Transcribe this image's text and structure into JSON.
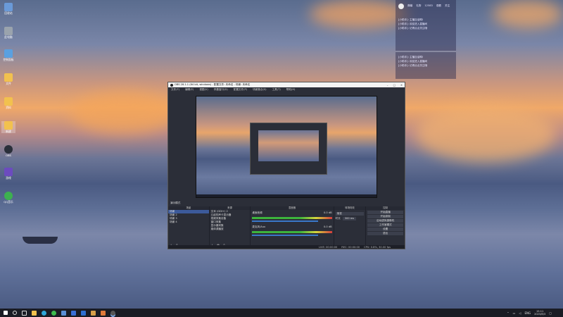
{
  "desktop": {
    "icons": [
      {
        "label": "回收站",
        "icon": "recycle-bin-icon",
        "color": "#6a9ad8"
      },
      {
        "label": "此电脑",
        "icon": "computer-icon",
        "color": "#9aa3ad"
      },
      {
        "label": "控制面板",
        "icon": "control-panel-icon",
        "color": "#5aa0e0"
      },
      {
        "label": "文件",
        "icon": "folder-icon",
        "color": "#f2c14e"
      },
      {
        "label": "资料",
        "icon": "folder-icon",
        "color": "#f2c14e"
      },
      {
        "label": "新建",
        "icon": "folder-icon",
        "color": "#f2c14e"
      },
      {
        "label": "OBS",
        "icon": "obs-icon",
        "color": "#2a2f3a"
      },
      {
        "label": "游戏",
        "icon": "game-icon",
        "color": "#6c4bbf"
      },
      {
        "label": "QQ音乐",
        "icon": "music-icon",
        "color": "#3db050"
      }
    ]
  },
  "chat_overlay": {
    "header": [
      "弹幕",
      "礼物",
      "12583",
      "观看",
      "关注"
    ],
    "lines_a": [
      "[小助手]: 主播加油鸭!",
      "[小助手]: 欢迎进入直播间",
      "[小助手]: 记得点点关注哦"
    ],
    "lines_b": [
      "[小助手]: 主播加油鸭!",
      "[小助手]: 欢迎进入直播间",
      "[小助手]: 记得点点关注哦"
    ]
  },
  "obs": {
    "title": "OBS 28.1.1 (64 bit, windows) - 配置文件: 未命名 - 场景: 未命名",
    "menu": [
      "文件(F)",
      "编辑(E)",
      "视图(V)",
      "停靠窗口(D)",
      "配置文件(P)",
      "场景集合(S)",
      "工具(T)",
      "帮助(H)"
    ],
    "mode_label": "演示模式",
    "docks": {
      "scenes": {
        "title": "场景",
        "items": [
          "场景",
          "场景 2",
          "场景 3",
          "场景 4"
        ]
      },
      "sources": {
        "title": "来源",
        "items": [
          "文本 (GDI+) 2",
          "凸起的声卡显示器",
          "视频采集设备",
          "窗口采集",
          "显示器采集",
          "媒体源播放"
        ]
      },
      "mixer": {
        "title": "混音器",
        "ch1": "桌面音频",
        "ch2": "麦克风/Aux",
        "ch1_db": "0.0 dB",
        "ch2_db": "0.0 dB"
      },
      "transitions": {
        "title": "转场特效",
        "type": "渐变",
        "duration_label": "时长",
        "duration": "300 ms"
      },
      "controls": {
        "title": "控制",
        "buttons": [
          "开始直播",
          "开始录制",
          "启动虚拟摄像机",
          "工作室模式",
          "设置",
          "退出"
        ]
      }
    },
    "status": [
      "LIVE: 00:00:00",
      "REC: 00:00:00",
      "CPU: 0.8%, 30.00 fps"
    ]
  },
  "taskbar": {
    "time": "15:11",
    "date": "2023/8/3",
    "lang": "ENG"
  }
}
